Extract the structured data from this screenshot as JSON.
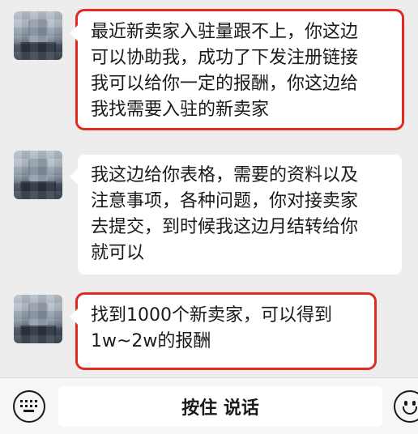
{
  "messages": [
    {
      "sender": "other",
      "highlighted": true,
      "lines": [
        "最近新卖家入驻量跟不上，你这边",
        "可以协助我，成功了下发注册链接",
        "我可以给你一定的报酬，你这边给",
        "我找需要入驻的新卖家"
      ]
    },
    {
      "sender": "other",
      "highlighted": false,
      "lines": [
        "我这边给你表格，需要的资料以及",
        "注意事项，各种问题，你对接卖家",
        "去提交，到时候我这边月结转给你",
        "就可以"
      ]
    },
    {
      "sender": "other",
      "highlighted": true,
      "lines": [
        "找到1000个新卖家，可以得到",
        "1w~2w的报酬"
      ]
    }
  ],
  "input_bar": {
    "left_icon": "keyboard-icon",
    "hold_to_talk_label": "按住 说话",
    "right_icon": "emoji-icon"
  },
  "colors": {
    "background": "#ededed",
    "bubble": "#ffffff",
    "highlight_border": "#e02b20"
  }
}
